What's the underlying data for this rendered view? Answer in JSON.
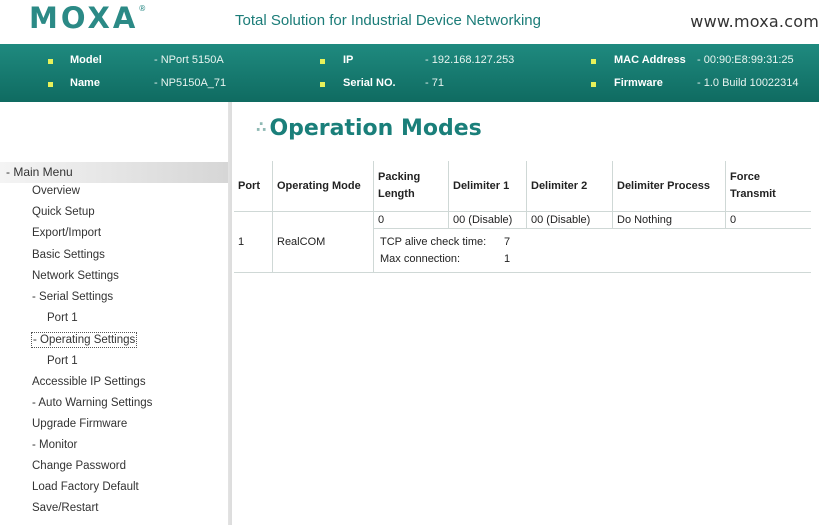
{
  "header": {
    "logo": "MOXA",
    "logo_mark": "®",
    "tagline": "Total Solution for Industrial Device Networking",
    "website": "www.moxa.com"
  },
  "info": {
    "model_label": "Model",
    "model_value": "- NPort 5150A",
    "name_label": "Name",
    "name_value": "- NP5150A_71",
    "ip_label": "IP",
    "ip_value": "- 192.168.127.253",
    "serial_label": "Serial NO.",
    "serial_value": "- 71",
    "mac_label": "MAC Address",
    "mac_value": "- 00:90:E8:99:31:25",
    "firmware_label": "Firmware",
    "firmware_value": "- 1.0 Build 10022314"
  },
  "menu": {
    "header": "- Main Menu",
    "items": [
      "Overview",
      "Quick Setup",
      "Export/Import",
      "Basic Settings",
      "Network Settings",
      "- Serial Settings",
      "Port 1",
      "- Operating Settings",
      "Port 1",
      "Accessible IP Settings",
      "- Auto Warning Settings",
      "Upgrade Firmware",
      "- Monitor",
      "Change Password",
      "Load Factory Default",
      "Save/Restart"
    ]
  },
  "page": {
    "title": "Operation Modes",
    "title_dots": "∴"
  },
  "table": {
    "headers": {
      "port": "Port",
      "mode": "Operating Mode",
      "packing_1": "Packing",
      "packing_2": "Length",
      "delim1": "Delimiter 1",
      "delim2": "Delimiter 2",
      "delim_process": "Delimiter Process",
      "force_1": "Force",
      "force_2": "Transmit"
    },
    "row": {
      "port": "1",
      "mode": "RealCOM",
      "packing": "0",
      "delim1": "00 (Disable)",
      "delim2": "00 (Disable)",
      "delim_process": "Do Nothing",
      "force": "0",
      "tcp_alive_label": "TCP alive check time:",
      "tcp_alive_value": "7",
      "max_conn_label": "Max connection:",
      "max_conn_value": "1"
    }
  },
  "colors": {
    "brand_teal": "#1a7f7a",
    "infobar_green": "#0f6b61",
    "bullet_yellow": "#e7f15a"
  }
}
